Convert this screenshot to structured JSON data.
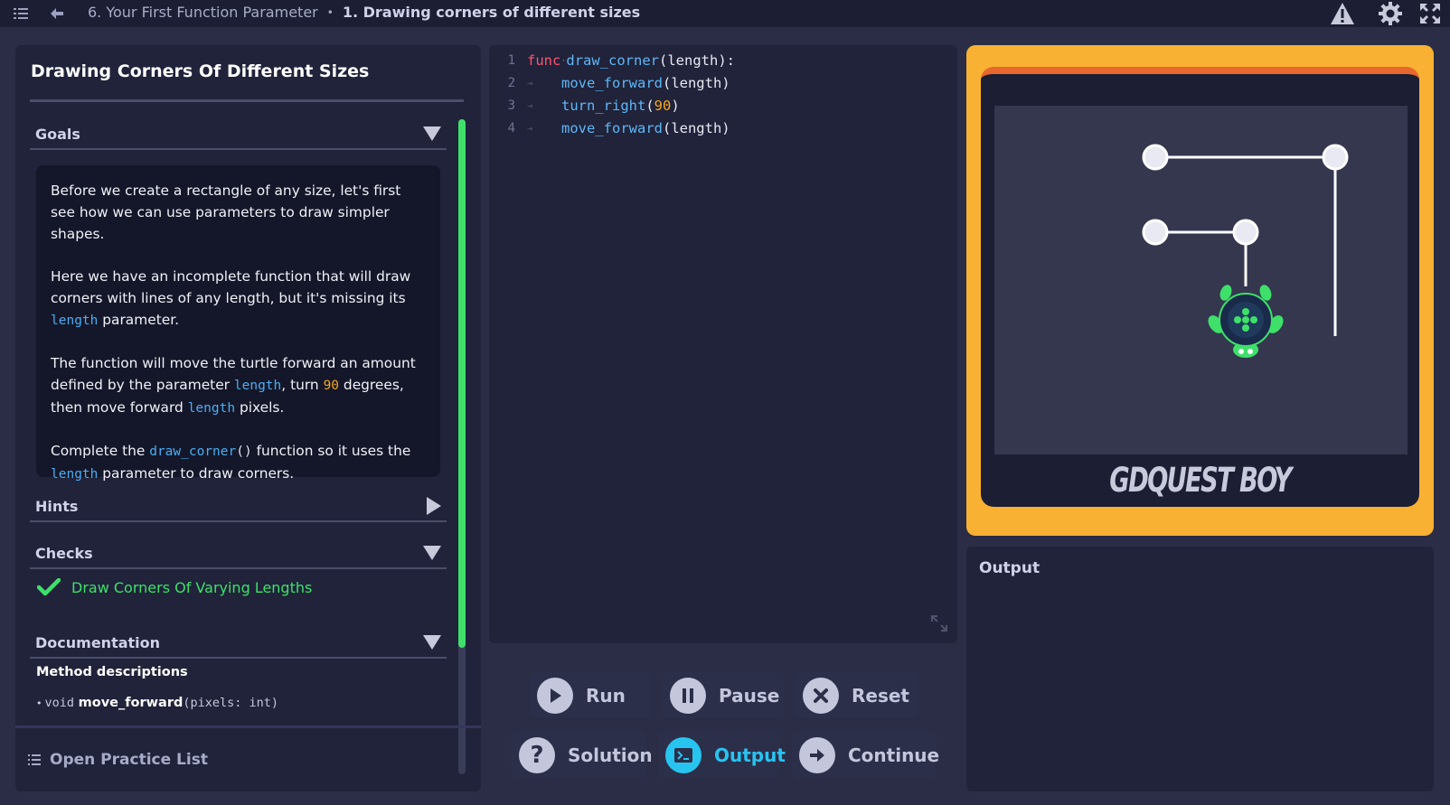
{
  "breadcrumbs": {
    "chapter": "6. Your First Function Parameter",
    "separator": "•",
    "lesson": "1. Drawing corners of different sizes"
  },
  "icons": {
    "menu": "menu-icon",
    "back": "back-arrow-icon",
    "warning": "warning-icon",
    "settings": "gear-icon",
    "fullscreen": "fullscreen-icon"
  },
  "left_panel": {
    "title": "Drawing Corners Of Different Sizes",
    "sections": {
      "goals": "Goals",
      "hints": "Hints",
      "checks": "Checks",
      "documentation": "Documentation"
    },
    "goals": {
      "p1": "Before we create a rectangle of any size, let's first see how we can use parameters to draw simpler shapes.",
      "p2_a": "Here we have an incomplete function that will draw corners with lines of any length, but it's missing its ",
      "p2_code": "length",
      "p2_b": " parameter.",
      "p3_a": "The function will move the turtle forward an amount defined by the parameter ",
      "p3_code1": "length",
      "p3_b": ", turn ",
      "p3_num": "90",
      "p3_c": " degrees, then move forward ",
      "p3_code2": "length",
      "p3_d": " pixels.",
      "p4_a": "Complete the ",
      "p4_code1": "draw_corner",
      "p4_parens": "()",
      "p4_b": " function so it uses the ",
      "p4_code2": "length",
      "p4_c": " parameter to draw corners."
    },
    "checks": [
      {
        "label": "Draw Corners Of Varying Lengths",
        "passed": true
      }
    ],
    "documentation": {
      "subheading": "Method descriptions",
      "bullet": "•",
      "method_type": "void",
      "method_name": "move_forward",
      "method_args": "(pixels: int)"
    },
    "practice_list": "Open Practice List"
  },
  "editor": {
    "lines": [
      {
        "num": "1",
        "keyword": "func",
        "dot": "·",
        "name": "draw_corner",
        "rest": "(length):"
      },
      {
        "num": "2",
        "name": "move_forward",
        "rest": "(length)"
      },
      {
        "num": "3",
        "name": "turn_right",
        "open": "(",
        "arg": "90",
        "close": ")"
      },
      {
        "num": "4",
        "name": "move_forward",
        "rest": "(length)"
      }
    ],
    "tab_marker": "⇥"
  },
  "buttons": {
    "run": "Run",
    "pause": "Pause",
    "reset": "Reset",
    "solution": "Solution",
    "output": "Output",
    "continue": "Continue"
  },
  "game": {
    "brand": "GDQUEST BOY"
  },
  "output_panel": {
    "label": "Output",
    "content": ""
  },
  "colors": {
    "accent_green": "#3ee06a",
    "accent_cyan": "#28c4f0",
    "frame_orange": "#f8b133",
    "keyword_red": "#ff5470",
    "identifier_blue": "#5fb7f7",
    "number_orange": "#f5a623"
  }
}
